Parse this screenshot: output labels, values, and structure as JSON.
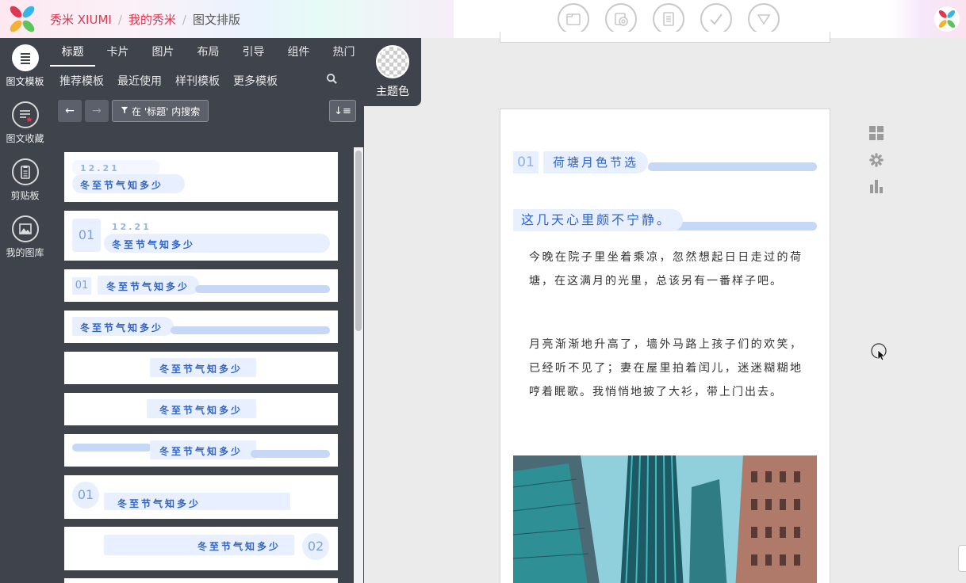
{
  "header": {
    "breadcrumb": [
      "秀米 XIUMI",
      "我的秀米",
      "图文排版"
    ],
    "separator": "/",
    "toolbar_icons": [
      "folder-icon",
      "stamp-icon",
      "document-icon",
      "check-icon",
      "dropdown-icon"
    ]
  },
  "leftnav": {
    "items": [
      {
        "label": "图文模板",
        "icon": "list-icon",
        "active": true
      },
      {
        "label": "图文收藏",
        "icon": "star-list-icon",
        "active": false
      },
      {
        "label": "剪贴板",
        "icon": "clipboard-icon",
        "active": false
      },
      {
        "label": "我的图库",
        "icon": "image-icon",
        "active": false
      }
    ]
  },
  "categories": {
    "tabs": [
      "标题",
      "卡片",
      "图片",
      "布局",
      "引导",
      "组件",
      "热门"
    ],
    "active_tab": "标题",
    "subtabs": [
      "推荐模板",
      "最近使用",
      "样刊模板",
      "更多模板"
    ]
  },
  "theme": {
    "label": "主题色"
  },
  "toolbar": {
    "back": "←",
    "forward": "→",
    "filter_label": "在 '标题' 内搜索",
    "sort": "↓≡"
  },
  "templates": {
    "date": "12.21",
    "title": "冬至节气知多少",
    "num01": "01",
    "num02": "02"
  },
  "article": {
    "num": "01",
    "title": "荷塘月色节选",
    "subtitle": "这几天心里颇不宁静。",
    "paragraphs": [
      "今晚在院子里坐着乘凉，忽然想起日日走过的荷塘，在这满月的光里，总该另有一番样子吧。",
      "月亮渐渐地升高了，墙外马路上孩子们的欢笑，已经听不见了；妻在屋里拍着闰儿，迷迷糊糊地哼着眠歌。我悄悄地披了大衫，带上门出去。"
    ]
  },
  "colors": {
    "accent": "#e0364f",
    "panel": "#3f434c",
    "template_blue": "#2f64c8",
    "template_pill": "#e8efff",
    "template_bar": "#c7d7f6"
  }
}
